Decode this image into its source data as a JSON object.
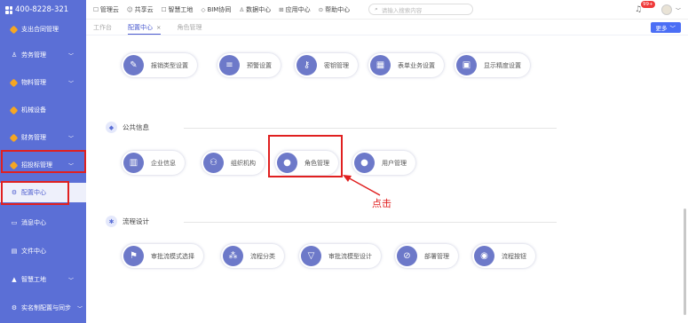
{
  "sidebar": {
    "phone": "400-8228-321",
    "items": [
      {
        "label": "支出合同管理",
        "icon": "gem",
        "chev": ""
      },
      {
        "label": "劳务管理",
        "icon": "people",
        "chev": "﹀"
      },
      {
        "label": "物料管理",
        "icon": "gem",
        "chev": "﹀"
      },
      {
        "label": "机械设备",
        "icon": "gem",
        "chev": ""
      },
      {
        "label": "财务管理",
        "icon": "gem",
        "chev": "﹀"
      },
      {
        "label": "招投标管理",
        "icon": "gem",
        "chev": "﹀"
      },
      {
        "label": "配置中心",
        "icon": "gear",
        "chev": ""
      },
      {
        "label": "消息中心",
        "icon": "chat",
        "chev": ""
      },
      {
        "label": "文件中心",
        "icon": "file",
        "chev": ""
      },
      {
        "label": "智慧工地",
        "icon": "helmet",
        "chev": "﹀"
      },
      {
        "label": "实名制配置与同步",
        "icon": "gear",
        "chev": "﹀"
      }
    ]
  },
  "topbar": {
    "items": [
      {
        "label": "管理云",
        "icon": "☐"
      },
      {
        "label": "共享云",
        "icon": "☺"
      },
      {
        "label": "智慧工地",
        "icon": "☐"
      },
      {
        "label": "BIM协同",
        "icon": "◇"
      },
      {
        "label": "数据中心",
        "icon": "♙"
      },
      {
        "label": "应用中心",
        "icon": "⊞"
      },
      {
        "label": "帮助中心",
        "icon": "⊙"
      }
    ],
    "search_placeholder": "请输入搜索内容",
    "badge": "99+"
  },
  "tabs": [
    {
      "label": "工作台",
      "active": false,
      "closable": false
    },
    {
      "label": "配置中心",
      "active": true,
      "closable": true
    },
    {
      "label": "角色管理",
      "active": false,
      "closable": false
    }
  ],
  "more_label": "更多",
  "row1": [
    "报销类型设置",
    "预警设置",
    "密钥管理",
    "表单业务设置",
    "显示精度设置"
  ],
  "section_public": "公共信息",
  "row2": [
    "企业信息",
    "组织机构",
    "角色管理",
    "用户管理"
  ],
  "callout": "点击",
  "section_flow": "流程设计",
  "row3": [
    "审批流模式选择",
    "流程分类",
    "审批流模型设计",
    "部署管理",
    "流程按钮"
  ],
  "colors": {
    "sidebar": "#5b6fd6",
    "accent": "#4b5bcf",
    "highlight": "#e02020",
    "icon_bg": "#6d79c9"
  }
}
